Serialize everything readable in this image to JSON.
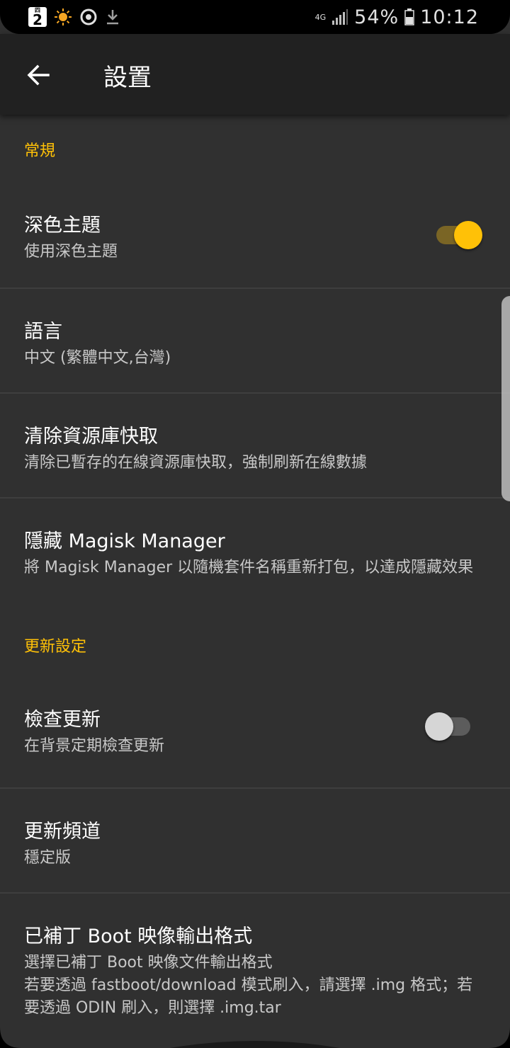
{
  "status_bar": {
    "badge_top": "四",
    "badge_number": "2",
    "network": "4G",
    "battery_percent": "54%",
    "time": "10:12",
    "icons": [
      "sim-badge-icon",
      "weather-sun-icon",
      "sync-circle-icon",
      "download-icon",
      "signal-icon",
      "battery-icon"
    ]
  },
  "toolbar": {
    "title": "設置",
    "back_icon": "arrow-back-icon"
  },
  "accent_color": "#ffc107",
  "sections": [
    {
      "header": "常規"
    },
    {
      "header": "更新設定"
    }
  ],
  "prefs": {
    "dark_theme": {
      "title": "深色主題",
      "summary": "使用深色主題",
      "enabled": true
    },
    "language": {
      "title": "語言",
      "summary": "中文 (繁體中文,台灣)"
    },
    "clear_cache": {
      "title": "清除資源庫快取",
      "summary": "清除已暫存的在線資源庫快取，強制刷新在線數據"
    },
    "hide_manager": {
      "title": "隱藏 Magisk Manager",
      "summary": "將 Magisk Manager 以隨機套件名稱重新打包，以達成隱藏效果"
    },
    "check_update": {
      "title": "檢查更新",
      "summary": "在背景定期檢查更新",
      "enabled": false
    },
    "update_channel": {
      "title": "更新頻道",
      "summary": "穩定版"
    },
    "boot_format": {
      "title": "已補丁 Boot 映像輸出格式",
      "summary_line1": "選擇已補丁 Boot 映像文件輸出格式",
      "summary_line2": "若要透過 fastboot/download 模式刷入，請選擇 .img 格式；若要透過 ODIN 刷入，則選擇 .img.tar"
    }
  }
}
